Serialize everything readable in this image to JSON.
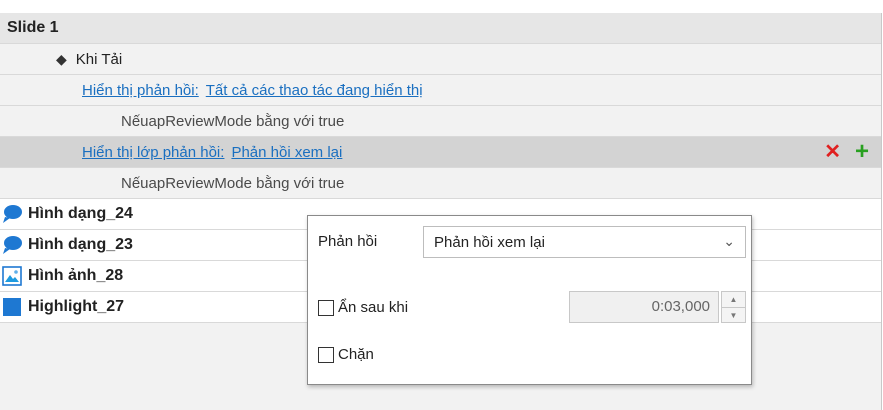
{
  "tree": {
    "slide_label": "Slide 1",
    "event_label": "Khi Tải",
    "action1": {
      "label": "Hiển thị phản hồi:",
      "value": "Tất cả các thao tác đang hiển thị"
    },
    "condition1": "NếuapReviewMode bằng với true",
    "action2": {
      "label": "Hiển thị lớp phản hồi:",
      "value": "Phản hồi xem lại"
    },
    "condition2": "NếuapReviewMode bằng với true",
    "objects": [
      {
        "label": "Hình dạng_24",
        "icon": "speech-bubble-icon"
      },
      {
        "label": "Hình dạng_23",
        "icon": "speech-bubble-icon"
      },
      {
        "label": "Hình ảnh_28",
        "icon": "picture-icon"
      },
      {
        "label": "Highlight_27",
        "icon": "blue-square-icon"
      }
    ]
  },
  "popup": {
    "feedback_label": "Phản hồi",
    "feedback_value": "Phản hồi xem lại",
    "hide_after_label": "Ẩn sau khi",
    "hide_after_value": "0:03,000",
    "block_label": "Chặn"
  },
  "colors": {
    "link": "#1a6fc0",
    "delete": "#e02020",
    "add": "#28a020",
    "icon_blue": "#1e78d2"
  }
}
